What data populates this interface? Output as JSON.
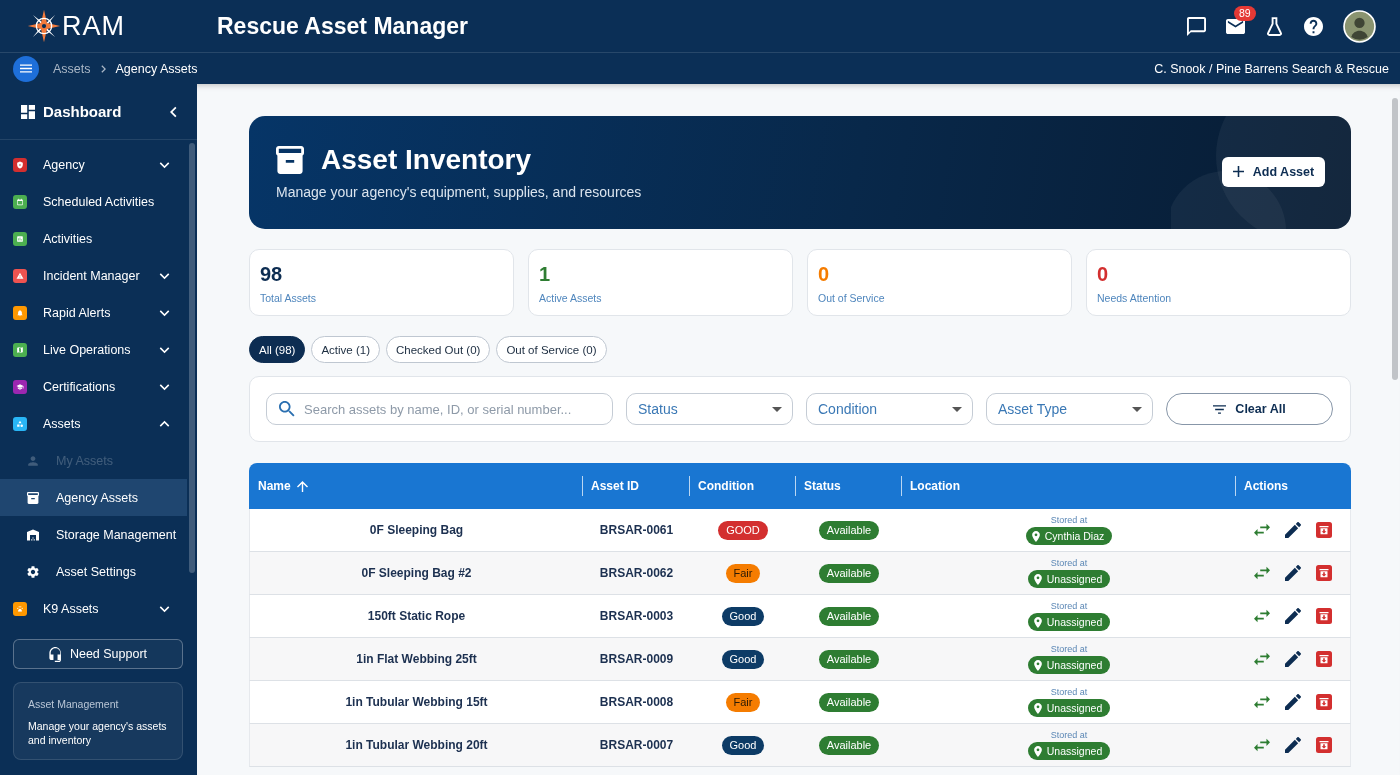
{
  "header": {
    "logo_text": "RAM",
    "title": "Rescue Asset Manager",
    "mail_badge": "89"
  },
  "breadcrumb": {
    "items": [
      {
        "label": "Assets",
        "current": false
      },
      {
        "label": "Agency Assets",
        "current": true
      }
    ],
    "user": "C. Snook / Pine Barrens Search & Rescue"
  },
  "sidebar": {
    "title": "Dashboard",
    "items": [
      {
        "kind": "menu",
        "label": "Agency",
        "color": "#d32f2f",
        "expanded": false
      },
      {
        "kind": "link",
        "label": "Scheduled Activities",
        "color": "#4caf50"
      },
      {
        "kind": "link",
        "label": "Activities",
        "color": "#4caf50"
      },
      {
        "kind": "menu",
        "label": "Incident Manager",
        "color": "#ef5350",
        "expanded": false
      },
      {
        "kind": "menu",
        "label": "Rapid Alerts",
        "color": "#ff9800",
        "expanded": false
      },
      {
        "kind": "menu",
        "label": "Live Operations",
        "color": "#4caf50",
        "expanded": false
      },
      {
        "kind": "menu",
        "label": "Certifications",
        "color": "#9c27b0",
        "expanded": false
      },
      {
        "kind": "menu",
        "label": "Assets",
        "color": "#29b6f6",
        "expanded": true,
        "children": [
          {
            "label": "My Assets",
            "selected": false,
            "disabled": true
          },
          {
            "label": "Agency Assets",
            "selected": true,
            "disabled": false
          },
          {
            "label": "Storage Management",
            "selected": false,
            "disabled": false
          },
          {
            "label": "Asset Settings",
            "selected": false,
            "disabled": false
          }
        ]
      },
      {
        "kind": "menu",
        "label": "K9 Assets",
        "color": "#ff9800",
        "expanded": false
      }
    ],
    "support_button": "Need Support",
    "info_card": {
      "title": "Asset Management",
      "text": "Manage your agency's assets and inventory"
    }
  },
  "banner": {
    "title": "Asset Inventory",
    "subtitle": "Manage your agency's equipment, supplies, and resources",
    "button": "Add Asset"
  },
  "stats": [
    {
      "value": "98",
      "label": "Total Assets",
      "color": "#0d2d52"
    },
    {
      "value": "1",
      "label": "Active Assets",
      "color": "#2e7d32"
    },
    {
      "value": "0",
      "label": "Out of Service",
      "color": "#f57c00"
    },
    {
      "value": "0",
      "label": "Needs Attention",
      "color": "#d32f2f"
    }
  ],
  "filter_tabs": [
    {
      "label": "All (98)",
      "selected": true
    },
    {
      "label": "Active (1)",
      "selected": false
    },
    {
      "label": "Checked Out (0)",
      "selected": false
    },
    {
      "label": "Out of Service (0)",
      "selected": false
    }
  ],
  "filters": {
    "search": {
      "placeholder": "Search assets by name, ID, or serial number..."
    },
    "selects": [
      {
        "label": "Status"
      },
      {
        "label": "Condition"
      },
      {
        "label": "Asset Type"
      }
    ],
    "clear_button": "Clear All"
  },
  "table": {
    "columns": [
      {
        "label": "Name",
        "sorted": true
      },
      {
        "label": "Asset ID",
        "sorted": false
      },
      {
        "label": "Condition",
        "sorted": false
      },
      {
        "label": "Status",
        "sorted": false
      },
      {
        "label": "Location",
        "sorted": false
      },
      {
        "label": "Actions",
        "sorted": false
      }
    ],
    "rows": [
      {
        "name": "0F Sleeping Bag",
        "asset_id": "BRSAR-0061",
        "condition": {
          "label": "GOOD",
          "color": "#d32f2f"
        },
        "status": "Available",
        "location": {
          "caption": "Stored at",
          "value": "Cynthia Diaz"
        }
      },
      {
        "name": "0F Sleeping Bag #2",
        "asset_id": "BRSAR-0062",
        "condition": {
          "label": "Fair",
          "color": "#f57c00"
        },
        "status": "Available",
        "location": {
          "caption": "Stored at",
          "value": "Unassigned"
        }
      },
      {
        "name": "150ft Static Rope",
        "asset_id": "BRSAR-0003",
        "condition": {
          "label": "Good",
          "color": "#0d3b66"
        },
        "status": "Available",
        "location": {
          "caption": "Stored at",
          "value": "Unassigned"
        }
      },
      {
        "name": "1in Flat Webbing 25ft",
        "asset_id": "BRSAR-0009",
        "condition": {
          "label": "Good",
          "color": "#0d3b66"
        },
        "status": "Available",
        "location": {
          "caption": "Stored at",
          "value": "Unassigned"
        }
      },
      {
        "name": "1in Tubular Webbing 15ft",
        "asset_id": "BRSAR-0008",
        "condition": {
          "label": "Fair",
          "color": "#f57c00"
        },
        "status": "Available",
        "location": {
          "caption": "Stored at",
          "value": "Unassigned"
        }
      },
      {
        "name": "1in Tubular Webbing 20ft",
        "asset_id": "BRSAR-0007",
        "condition": {
          "label": "Good",
          "color": "#0d3b66"
        },
        "status": "Available",
        "location": {
          "caption": "Stored at",
          "value": "Unassigned"
        }
      }
    ]
  }
}
